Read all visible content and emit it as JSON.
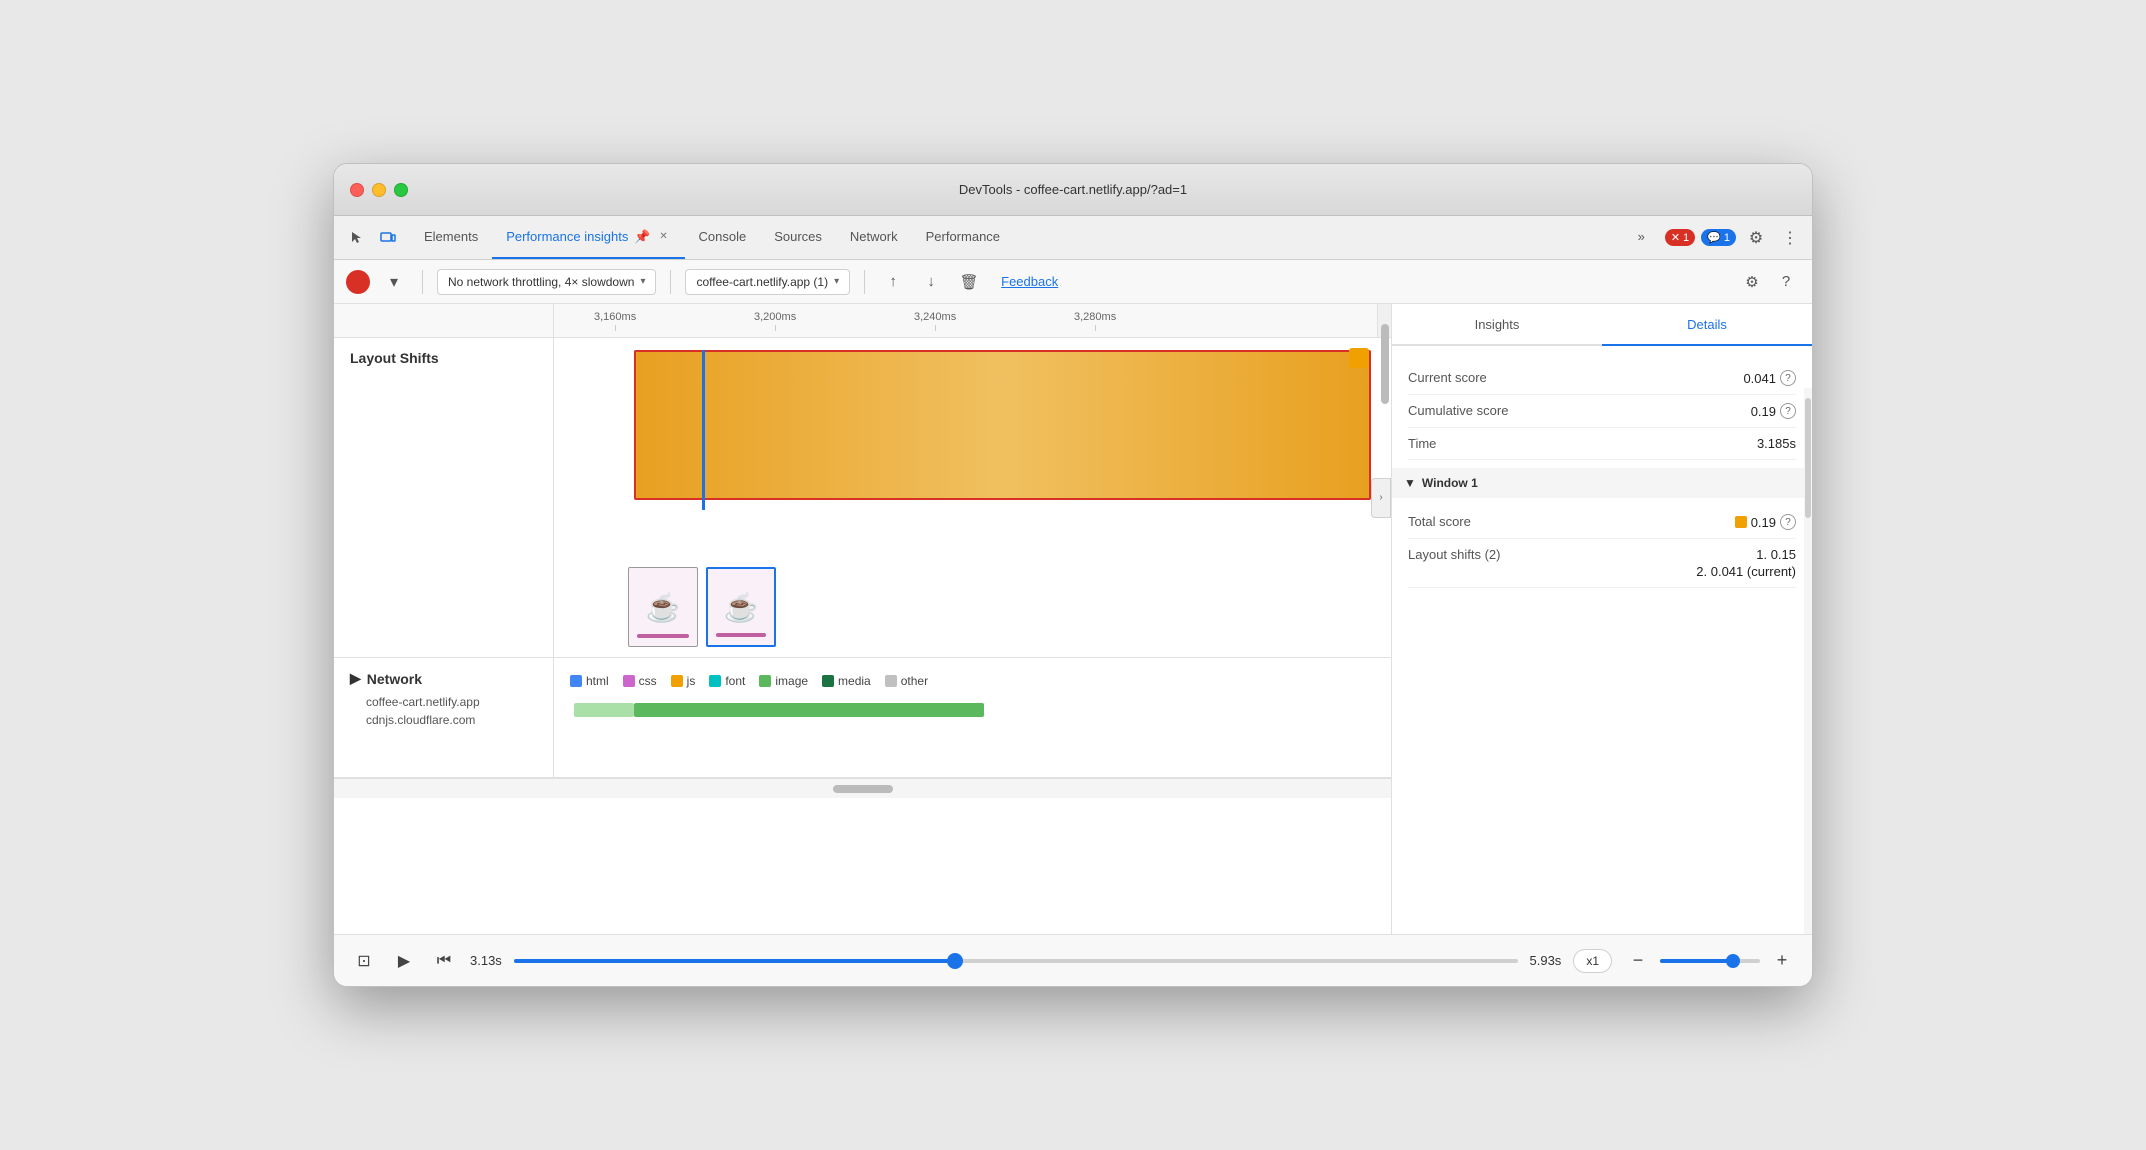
{
  "window": {
    "title": "DevTools - coffee-cart.netlify.app/?ad=1"
  },
  "tabs": {
    "items": [
      {
        "id": "elements",
        "label": "Elements",
        "active": false
      },
      {
        "id": "performance-insights",
        "label": "Performance insights",
        "active": true,
        "hasPin": true
      },
      {
        "id": "console",
        "label": "Console",
        "active": false
      },
      {
        "id": "sources",
        "label": "Sources",
        "active": false
      },
      {
        "id": "network",
        "label": "Network",
        "active": false
      },
      {
        "id": "performance",
        "label": "Performance",
        "active": false
      }
    ],
    "more_label": "»",
    "errors_count": "1",
    "info_count": "1"
  },
  "toolbar": {
    "throttling_label": "No network throttling, 4× slowdown",
    "profile_label": "coffee-cart.netlify.app (1)",
    "feedback_label": "Feedback"
  },
  "timeline": {
    "ticks": [
      "3,160ms",
      "3,200ms",
      "3,240ms",
      "3,280ms"
    ]
  },
  "layout_shifts": {
    "label": "Layout Shifts"
  },
  "legend": {
    "items": [
      {
        "id": "html",
        "label": "html",
        "color": "#4285f4"
      },
      {
        "id": "css",
        "label": "css",
        "color": "#cc66cc"
      },
      {
        "id": "js",
        "label": "js",
        "color": "#f0a000"
      },
      {
        "id": "font",
        "label": "font",
        "color": "#00c0c0"
      },
      {
        "id": "image",
        "label": "image",
        "color": "#5cb85c"
      },
      {
        "id": "media",
        "label": "media",
        "color": "#1a7340"
      },
      {
        "id": "other",
        "label": "other",
        "color": "#c0c0c0"
      }
    ]
  },
  "network": {
    "label": "Network",
    "urls": [
      "coffee-cart.netlify.app",
      "cdnjs.cloudflare.com"
    ]
  },
  "controls": {
    "time_start": "3.13s",
    "time_end": "5.93s",
    "speed": "x1",
    "progress_pct": 44
  },
  "right_panel": {
    "tabs": [
      {
        "id": "insights",
        "label": "Insights",
        "active": false
      },
      {
        "id": "details",
        "label": "Details",
        "active": true
      }
    ],
    "details": {
      "current_score_label": "Current score",
      "current_score_value": "0.041",
      "cumulative_score_label": "Cumulative score",
      "cumulative_score_value": "0.19",
      "time_label": "Time",
      "time_value": "3.185s",
      "window_label": "Window 1",
      "total_score_label": "Total score",
      "total_score_value": "0.19",
      "layout_shifts_label": "Layout shifts (2)",
      "layout_shift_1": "1. 0.15",
      "layout_shift_2": "2. 0.041 (current)"
    }
  }
}
